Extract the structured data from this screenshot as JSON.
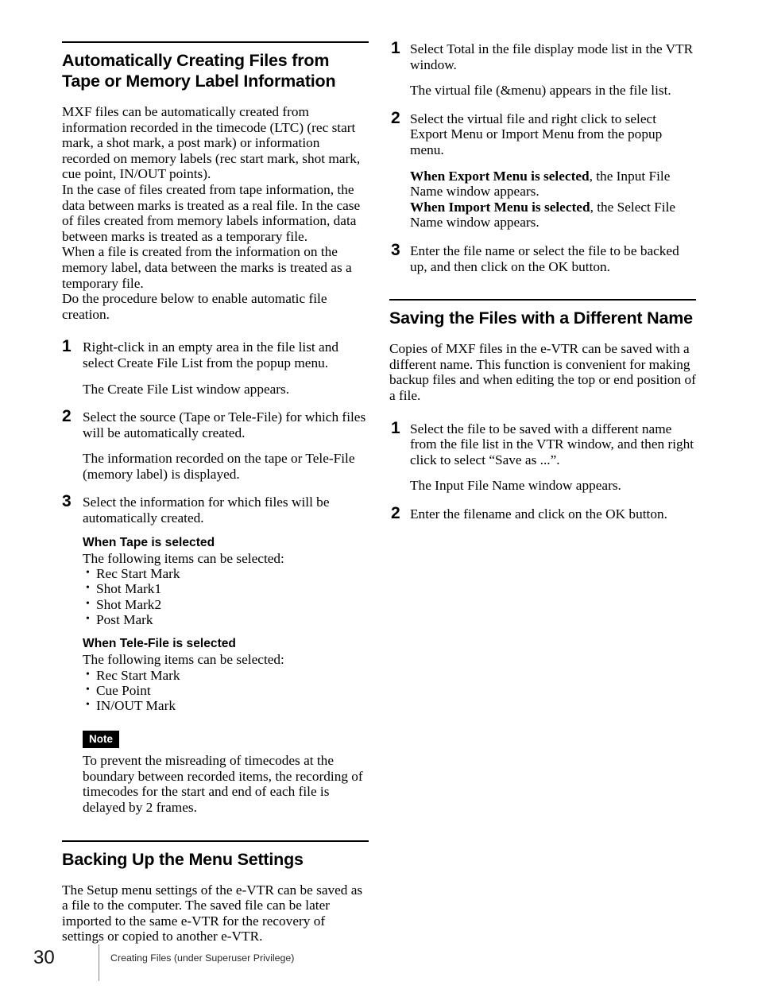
{
  "page": {
    "number": "30",
    "running_head": "Creating Files (under Superuser Privilege)"
  },
  "left_column": {
    "section1": {
      "title": "Automatically Creating Files from Tape or Memory Label Information",
      "intro": [
        "MXF files can be automatically created from information recorded in the timecode (LTC) (rec start mark, a shot mark, a post mark) or information recorded on memory labels (rec start mark, shot mark, cue point, IN/OUT points).",
        "In the case of files created from tape information, the data between marks is treated as a real file. In the case of files created from memory labels information, data between marks is treated as a temporary file.",
        "When a file is created from the information on the memory label, data between the marks is treated as a temporary file.",
        "Do the procedure below to enable automatic file creation."
      ],
      "steps": [
        {
          "number": "1",
          "text": "Right-click in an empty area in the file list and select Create File List from the popup menu.",
          "result": "The Create File List window appears."
        },
        {
          "number": "2",
          "text": "Select the source (Tape or Tele-File) for which files will be automatically created.",
          "result": "The information recorded on the tape or Tele-File (memory label) is displayed."
        },
        {
          "number": "3",
          "text": "Select the information for which files will be automatically created."
        }
      ],
      "tape_block": {
        "heading": "When Tape is selected",
        "lead": "The following items can be selected:",
        "items": [
          "Rec Start Mark",
          "Shot Mark1",
          "Shot Mark2",
          "Post Mark"
        ]
      },
      "telefile_block": {
        "heading": "When Tele-File is selected",
        "lead": "The following items can be selected:",
        "items": [
          "Rec Start Mark",
          "Cue Point",
          "IN/OUT Mark"
        ]
      },
      "note": {
        "label": "Note",
        "text": "To prevent the misreading of timecodes at the boundary between recorded items, the recording of timecodes for the start and end of each file is delayed by 2 frames."
      }
    },
    "section2": {
      "title": "Backing Up the Menu Settings",
      "intro": "The Setup menu settings of the e-VTR can be saved as a file to the computer. The saved file can be later imported to the same e-VTR for the recovery of settings or copied to another e-VTR."
    }
  },
  "right_column": {
    "continued_steps": [
      {
        "number": "1",
        "text": "Select Total in the file display mode list in the VTR window.",
        "result": "The virtual file (&menu) appears in the file list."
      },
      {
        "number": "2",
        "text": "Select the virtual file and right click to select Export Menu or Import Menu from the popup menu.",
        "result_bold_1": "When Export Menu is selected",
        "result_rest_1": ", the Input File Name window appears.",
        "result_bold_2": "When Import Menu is selected",
        "result_rest_2": ", the Select File Name window appears."
      },
      {
        "number": "3",
        "text": "Enter the file name or select the file to be backed up, and then click on the OK button."
      }
    ],
    "section3": {
      "title": "Saving the Files with a Different Name",
      "intro": "Copies of MXF files in the e-VTR can be saved with a different name. This function is convenient for making backup files and when editing the top or end position of a file.",
      "steps": [
        {
          "number": "1",
          "text": "Select the file to be saved with a different name from the file list in the VTR window, and then right click to select “Save as ...”.",
          "result": "The Input File Name window appears."
        },
        {
          "number": "2",
          "text": "Enter the filename and click on the OK button."
        }
      ]
    }
  }
}
